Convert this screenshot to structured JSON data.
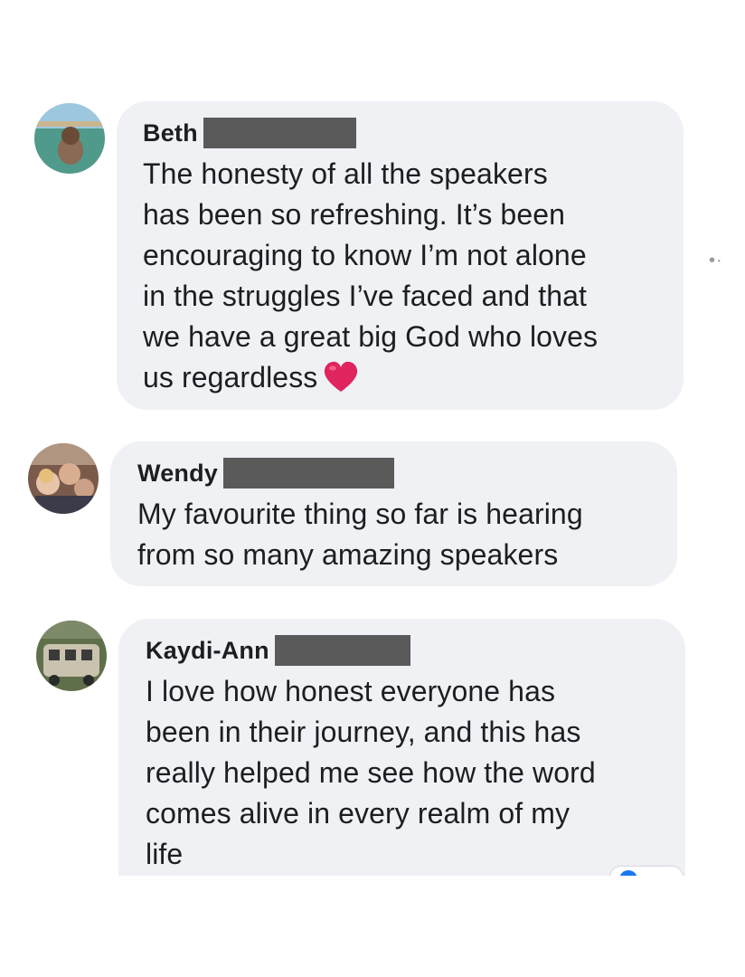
{
  "comments": [
    {
      "author": "Beth",
      "lines": [
        "The honesty of all the speakers",
        "has been so refreshing. It’s been",
        "encouraging to know I’m not alone",
        "in the struggles I’ve faced and that",
        "we have a great big God who loves",
        "us regardless"
      ],
      "emoji": "heart-emoji"
    },
    {
      "author": "Wendy",
      "lines": [
        "My favourite thing so far is hearing",
        "from so many amazing speakers"
      ]
    },
    {
      "author": "Kaydi-Ann",
      "lines": [
        "I love how honest everyone has",
        "been in their journey, and this has",
        "really helped me see how the word",
        "comes alive in every realm of my",
        "life"
      ]
    }
  ],
  "more_options": "•·",
  "colors": {
    "bubble": "#eff1f5",
    "text": "#1c1e21",
    "redaction": "#5a5a5a",
    "heart": "#e0245e",
    "reaction_icon": "#1877f2"
  }
}
